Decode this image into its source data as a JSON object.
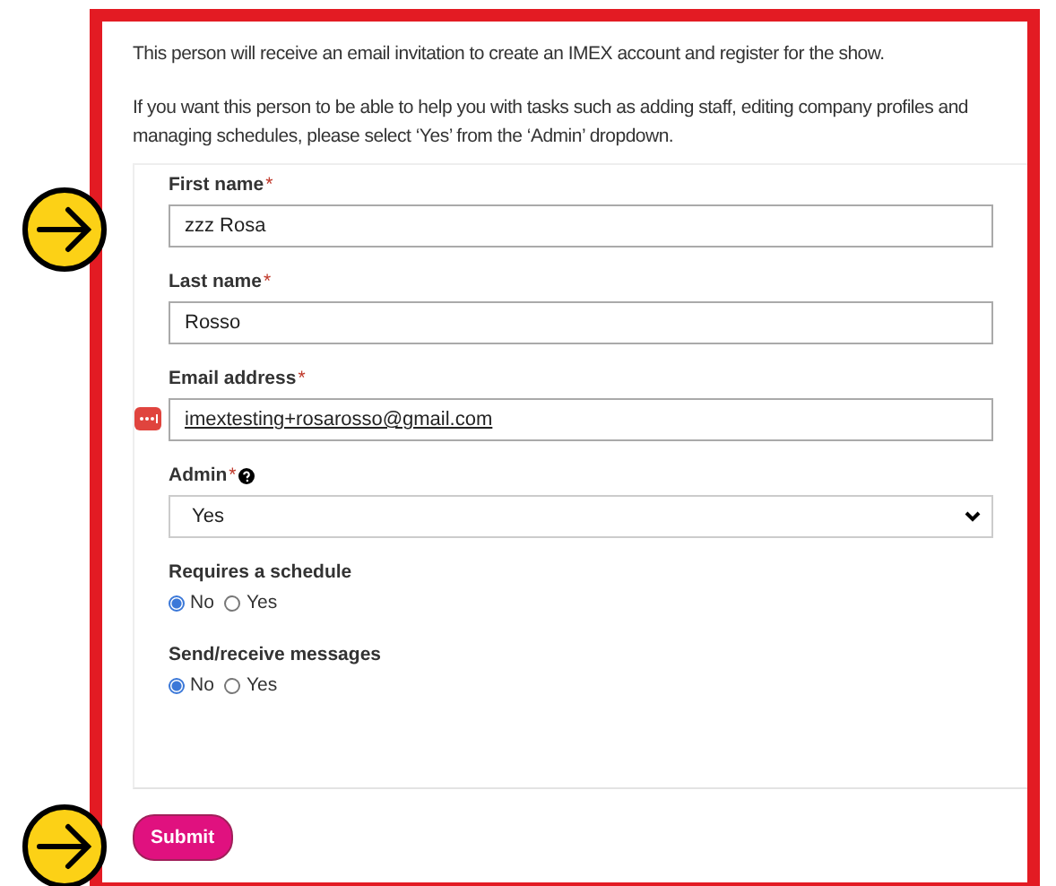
{
  "intro": [
    "This person will receive an email invitation to create an IMEX account and register for the show.",
    "If you want this person to be able to help you with tasks such as adding staff, editing company profiles and managing schedules, please select ‘Yes’ from the ‘Admin’ dropdown."
  ],
  "fields": [
    {
      "kind": "text",
      "label": "First name",
      "required_mark": "*",
      "value": "zzz Rosa",
      "marker": true,
      "autofill": false
    },
    {
      "kind": "text",
      "label": "Last name",
      "required_mark": "*",
      "value": "Rosso",
      "marker": false,
      "autofill": false
    },
    {
      "kind": "text",
      "label": "Email address",
      "required_mark": "*",
      "value": "imextesting+rosarosso@gmail.com",
      "marker": false,
      "autofill": true
    },
    {
      "kind": "select",
      "label": "Admin",
      "required_mark": "*",
      "help": true,
      "value": "Yes"
    },
    {
      "kind": "radio",
      "label": "Requires a schedule",
      "options": [
        {
          "label": "No",
          "selected": true
        },
        {
          "label": "Yes",
          "selected": false
        }
      ]
    },
    {
      "kind": "radio",
      "label": "Send/receive messages",
      "options": [
        {
          "label": "No",
          "selected": true
        },
        {
          "label": "Yes",
          "selected": false
        }
      ]
    }
  ],
  "submit": {
    "label": "Submit",
    "marker": true
  }
}
